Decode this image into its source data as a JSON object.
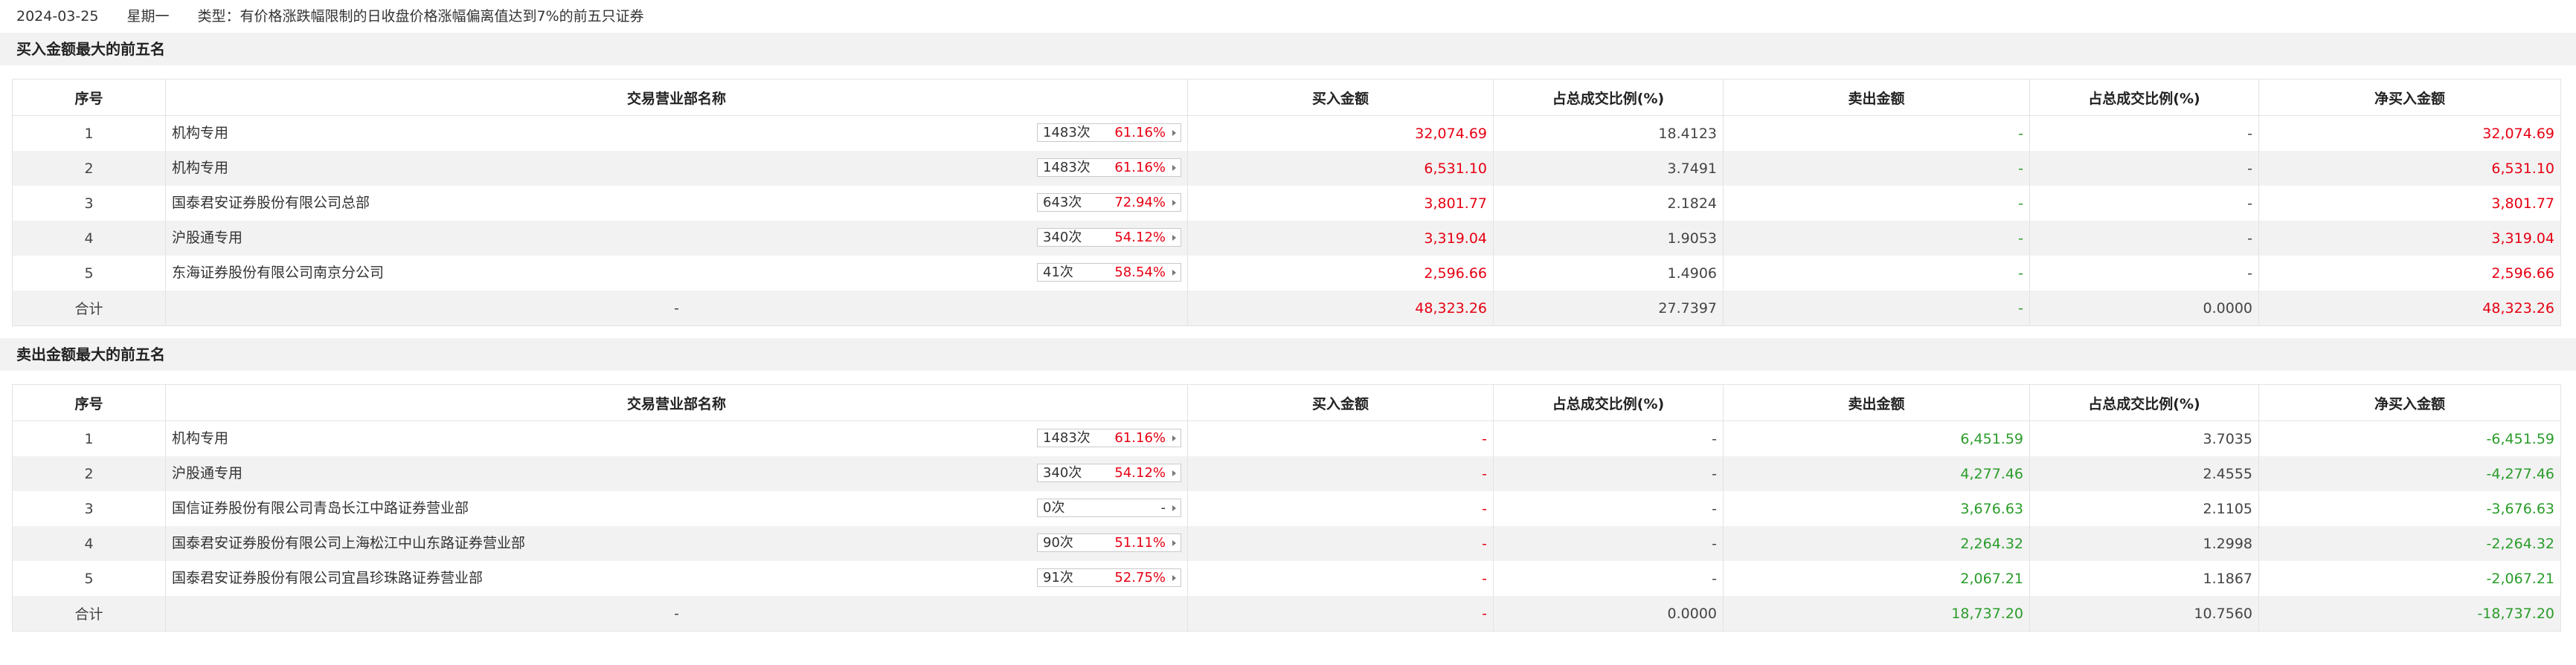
{
  "header": {
    "date": "2024-03-25",
    "weekday": "星期一",
    "type_text": "类型：有价格涨跌幅限制的日收盘价格涨幅偏离值达到7%的前五只证券"
  },
  "columns": {
    "seq": "序号",
    "dept": "交易营业部名称",
    "buy": "买入金额",
    "buy_pct": "占总成交比例(%)",
    "sell": "卖出金额",
    "sell_pct": "占总成交比例(%)",
    "net": "净买入金额"
  },
  "buy_section": {
    "title": "买入金额最大的前五名",
    "rows": [
      {
        "seq": "1",
        "name": "机构专用",
        "count": "1483次",
        "rate": "61.16%",
        "buy": "32,074.69",
        "buy_pct": "18.4123",
        "sell": "-",
        "sell_pct": "-",
        "net": "32,074.69"
      },
      {
        "seq": "2",
        "name": "机构专用",
        "count": "1483次",
        "rate": "61.16%",
        "buy": "6,531.10",
        "buy_pct": "3.7491",
        "sell": "-",
        "sell_pct": "-",
        "net": "6,531.10"
      },
      {
        "seq": "3",
        "name": "国泰君安证券股份有限公司总部",
        "count": "643次",
        "rate": "72.94%",
        "buy": "3,801.77",
        "buy_pct": "2.1824",
        "sell": "-",
        "sell_pct": "-",
        "net": "3,801.77"
      },
      {
        "seq": "4",
        "name": "沪股通专用",
        "count": "340次",
        "rate": "54.12%",
        "buy": "3,319.04",
        "buy_pct": "1.9053",
        "sell": "-",
        "sell_pct": "-",
        "net": "3,319.04"
      },
      {
        "seq": "5",
        "name": "东海证券股份有限公司南京分公司",
        "count": "41次",
        "rate": "58.54%",
        "buy": "2,596.66",
        "buy_pct": "1.4906",
        "sell": "-",
        "sell_pct": "-",
        "net": "2,596.66"
      }
    ],
    "total": {
      "label": "合计",
      "dept": "-",
      "buy": "48,323.26",
      "buy_pct": "27.7397",
      "sell": "-",
      "sell_pct": "0.0000",
      "net": "48,323.26"
    }
  },
  "sell_section": {
    "title": "卖出金额最大的前五名",
    "rows": [
      {
        "seq": "1",
        "name": "机构专用",
        "count": "1483次",
        "rate": "61.16%",
        "buy": "-",
        "buy_pct": "-",
        "sell": "6,451.59",
        "sell_pct": "3.7035",
        "net": "-6,451.59"
      },
      {
        "seq": "2",
        "name": "沪股通专用",
        "count": "340次",
        "rate": "54.12%",
        "buy": "-",
        "buy_pct": "-",
        "sell": "4,277.46",
        "sell_pct": "2.4555",
        "net": "-4,277.46"
      },
      {
        "seq": "3",
        "name": "国信证券股份有限公司青岛长江中路证券营业部",
        "count": "0次",
        "rate": "-",
        "buy": "-",
        "buy_pct": "-",
        "sell": "3,676.63",
        "sell_pct": "2.1105",
        "net": "-3,676.63"
      },
      {
        "seq": "4",
        "name": "国泰君安证券股份有限公司上海松江中山东路证券营业部",
        "count": "90次",
        "rate": "51.11%",
        "buy": "-",
        "buy_pct": "-",
        "sell": "2,264.32",
        "sell_pct": "1.2998",
        "net": "-2,264.32"
      },
      {
        "seq": "5",
        "name": "国泰君安证券股份有限公司宜昌珍珠路证券营业部",
        "count": "91次",
        "rate": "52.75%",
        "buy": "-",
        "buy_pct": "-",
        "sell": "2,067.21",
        "sell_pct": "1.1867",
        "net": "-2,067.21"
      }
    ],
    "total": {
      "label": "合计",
      "dept": "-",
      "buy": "-",
      "buy_pct": "0.0000",
      "sell": "18,737.20",
      "sell_pct": "10.7560",
      "net": "-18,737.20"
    }
  },
  "colors": {
    "red": "#e60012",
    "green": "#2a9c2a",
    "stripe": "#f2f2f2",
    "border": "#e3e3e3"
  }
}
